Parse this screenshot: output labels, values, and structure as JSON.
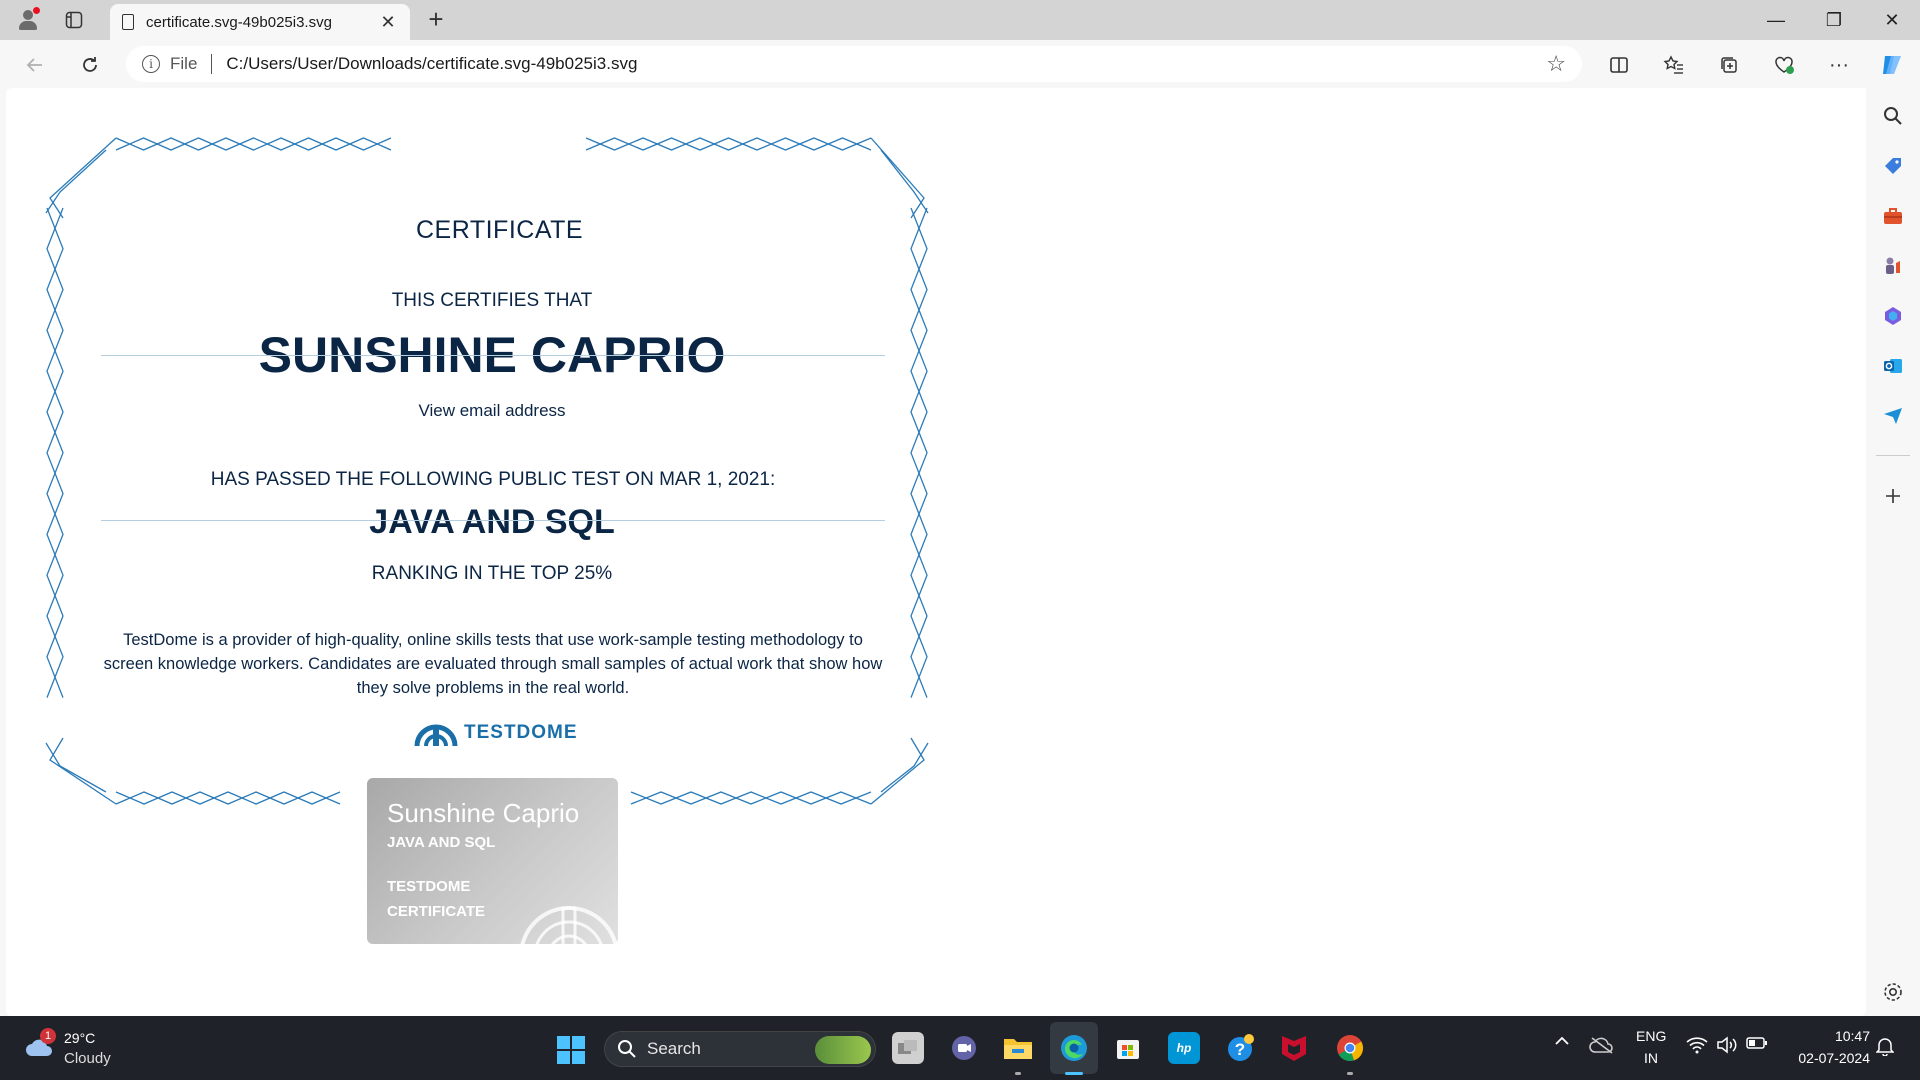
{
  "tab": {
    "title": "certificate.svg-49b025i3.svg",
    "close_label": "✕"
  },
  "window": {
    "new_tab_label": "+",
    "minimize_label": "—",
    "maximize_label": "❐",
    "close_label": "✕"
  },
  "address": {
    "scheme_label": "File",
    "url": "C:/Users/User/Downloads/certificate.svg-49b025i3.svg"
  },
  "certificate": {
    "heading": "CERTIFICATE",
    "certifies": "THIS CERTIFIES THAT",
    "name": "SUNSHINE CAPRIO",
    "email_link": "View email address",
    "passed": "HAS PASSED THE FOLLOWING PUBLIC TEST ON MAR 1, 2021:",
    "test_name": "JAVA AND SQL",
    "ranking": "RANKING IN THE TOP 25%",
    "description": "TestDome is a provider of high-quality, online skills tests that use work-sample testing methodology to screen knowledge workers. Candidates are evaluated through small samples of actual work that show how they solve problems in the real world.",
    "logo_text": "TESTDOME",
    "accent_color": "#0b2545",
    "border_color": "#2b7bb9"
  },
  "badge": {
    "name": "Sunshine Caprio",
    "test": "JAVA AND SQL",
    "line1": "TESTDOME",
    "line2": "CERTIFICATE"
  },
  "sidebar": {
    "items": [
      "search-icon",
      "tag-icon",
      "toolbox-icon",
      "games-icon",
      "copilot-365-icon",
      "outlook-icon",
      "send-icon",
      "add-icon",
      "settings-icon"
    ]
  },
  "taskbar": {
    "weather": {
      "temp": "29°C",
      "condition": "Cloudy",
      "alert_count": "1"
    },
    "search_label": "Search",
    "lang_line1": "ENG",
    "lang_line2": "IN",
    "time": "10:47",
    "date": "02-07-2024"
  }
}
